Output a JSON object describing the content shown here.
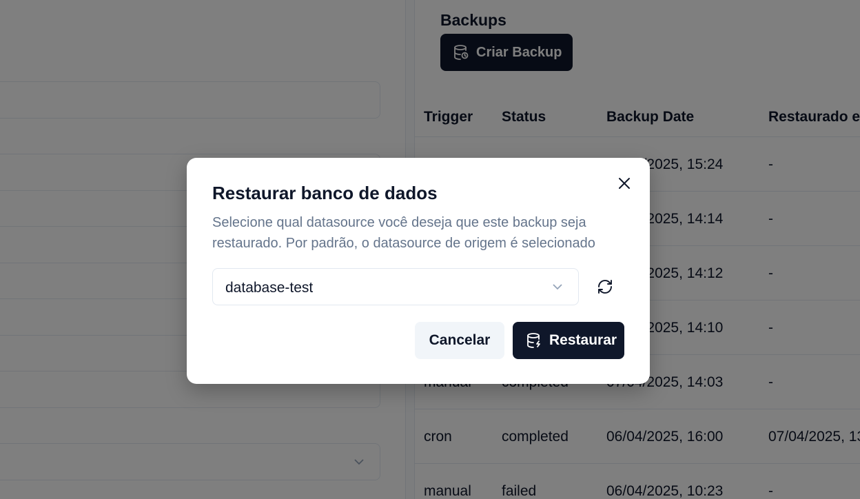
{
  "backups": {
    "title": "Backups",
    "create_button": "Criar Backup",
    "columns": [
      "Trigger",
      "Status",
      "Backup Date",
      "Restaurado em"
    ],
    "rows": [
      {
        "trigger": "",
        "status": "",
        "date": "07/04/2025, 15:24",
        "restored": "-"
      },
      {
        "trigger": "",
        "status": "",
        "date": "07/04/2025, 14:14",
        "restored": "-"
      },
      {
        "trigger": "",
        "status": "",
        "date": "07/04/2025, 14:12",
        "restored": "-"
      },
      {
        "trigger": "",
        "status": "",
        "date": "07/04/2025, 14:10",
        "restored": "-"
      },
      {
        "trigger": "manual",
        "status": "completed",
        "date": "07/04/2025, 14:03",
        "restored": "-"
      },
      {
        "trigger": "cron",
        "status": "completed",
        "date": "06/04/2025, 16:00",
        "restored": "07/04/2025, 13"
      },
      {
        "trigger": "manual",
        "status": "failed",
        "date": "06/04/2025, 10:23",
        "restored": "-"
      }
    ]
  },
  "dialog": {
    "title": "Restaurar banco de dados",
    "description": "Selecione qual datasource você deseja que este backup seja restaurado. Por padrão, o datasource de origem é selecionado",
    "datasource_value": "database-test",
    "cancel_label": "Cancelar",
    "restore_label": "Restaurar"
  },
  "colors": {
    "primary": "#0f172a",
    "muted_text": "#64748b",
    "border": "#e2e8f0",
    "overlay": "rgba(0,0,0,0.5)"
  }
}
